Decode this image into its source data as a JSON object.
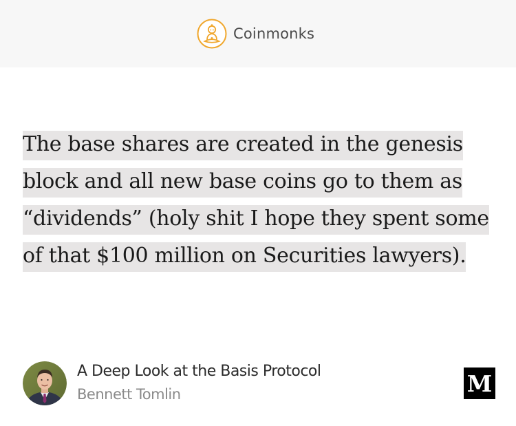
{
  "publication": {
    "name": "Coinmonks",
    "logo_icon": "meditating-monk-icon",
    "accent_color": "#f0a72d"
  },
  "quote": {
    "text": "The base shares are created in the genesis block and all new base coins go to them as “dividends” (holy shit I hope they spent some of that $100 million on Securities lawyers).",
    "highlight_color": "#e7e5e5"
  },
  "article": {
    "title": "A Deep Look at the Basis Protocol",
    "author": "Bennett Tomlin",
    "avatar_icon": "author-avatar"
  },
  "platform": {
    "logo_letter": "M",
    "logo_icon": "medium-logo-icon"
  }
}
